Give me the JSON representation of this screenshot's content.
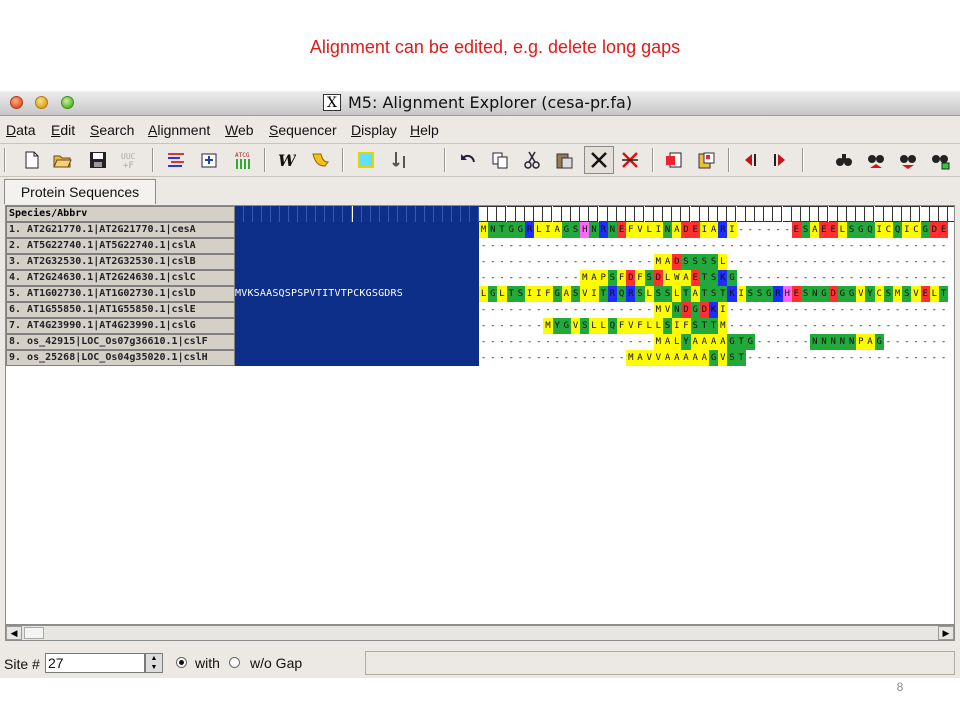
{
  "slide": {
    "title": "Alignment can be edited, e.g. delete long gaps",
    "page_number": "8"
  },
  "window": {
    "title": "M5: Alignment Explorer (cesa-pr.fa)",
    "x_icon": "X"
  },
  "menu": [
    "Data",
    "Edit",
    "Search",
    "Alignment",
    "Web",
    "Sequencer",
    "Display",
    "Help"
  ],
  "toolbar": {
    "icons": [
      "new-file-icon",
      "open-folder-icon",
      "save-icon",
      "translate-icon",
      "align-clustal-icon",
      "align-muscle-icon",
      "dna-icon",
      "w-icon",
      "muscle-arm-icon",
      "mark-site-icon",
      "move-sites-icon",
      "undo-icon",
      "copy-icon",
      "cut-icon",
      "paste-icon",
      "delete-icon",
      "delete-gap-columns-icon",
      "insert-block-icon",
      "paste-block-icon",
      "move-left-icon",
      "move-right-icon",
      "search-icon",
      "find-prev-icon",
      "find-next-icon",
      "find-motif-icon"
    ]
  },
  "tab": {
    "label": "Protein Sequences"
  },
  "grid": {
    "header": "Species/Abbrv",
    "rows": [
      {
        "name": "1. AT2G21770.1|AT2G21770.1|cesA"
      },
      {
        "name": "2. AT5G22740.1|AT5G22740.1|cslA"
      },
      {
        "name": "3. AT2G32530.1|AT2G32530.1|cslB"
      },
      {
        "name": "4. AT2G24630.1|AT2G24630.1|cslC"
      },
      {
        "name": "5. AT1G02730.1|AT1G02730.1|cslD"
      },
      {
        "name": "6. AT1G55850.1|AT1G55850.1|cslE"
      },
      {
        "name": "7. AT4G23990.1|AT4G23990.1|cslG"
      },
      {
        "name": "8. os_42915|LOC_Os07g36610.1|cslF"
      },
      {
        "name": "9. os_25268|LOC_Os04g35020.1|cslH"
      }
    ],
    "row5_navy_text": "MVKSAASQSPSPVTITVTPCKGSGDRS",
    "sequences": [
      "MNTGGRLIAGSHNRNEFVLINADEIARI------ESAEELSGQICQICGDEIE",
      "-----------------------------------------------------",
      "-------------------MADSSSSL--------------------------",
      "-----------MAPSFDFSDLWAETSKG-------------------------",
      "LGLTSIIFGASVITRQRSLSSLTATSTKISSGRHESNGDGGVYCSMSVELTP",
      "-------------------MVNDGDKI--------------------------",
      "-------MYGVSLLQFVFLLSIFSTTM--------------------------",
      "-------------------MALYAAAAGTG------NNNNNPAG---------",
      "----------------MAVVAAAAAGVST------------------------"
    ],
    "aa_colors": {
      "M": "#fffb00",
      "A": "#fffb00",
      "V": "#fffb00",
      "L": "#fffb00",
      "I": "#fffb00",
      "F": "#fffb00",
      "W": "#fffb00",
      "C": "#fffb00",
      "P": "#fffb00",
      "N": "#22a83b",
      "Q": "#22a83b",
      "G": "#22a83b",
      "S": "#22a83b",
      "T": "#22a83b",
      "Y": "#22a83b",
      "D": "#ff3030",
      "E": "#ff3030",
      "K": "#1c2fff",
      "R": "#1c2fff",
      "H": "#ff66ff"
    }
  },
  "status": {
    "site_label": "Site #",
    "site_value": "27",
    "radio_with": "with",
    "radio_without": "w/o Gap"
  }
}
